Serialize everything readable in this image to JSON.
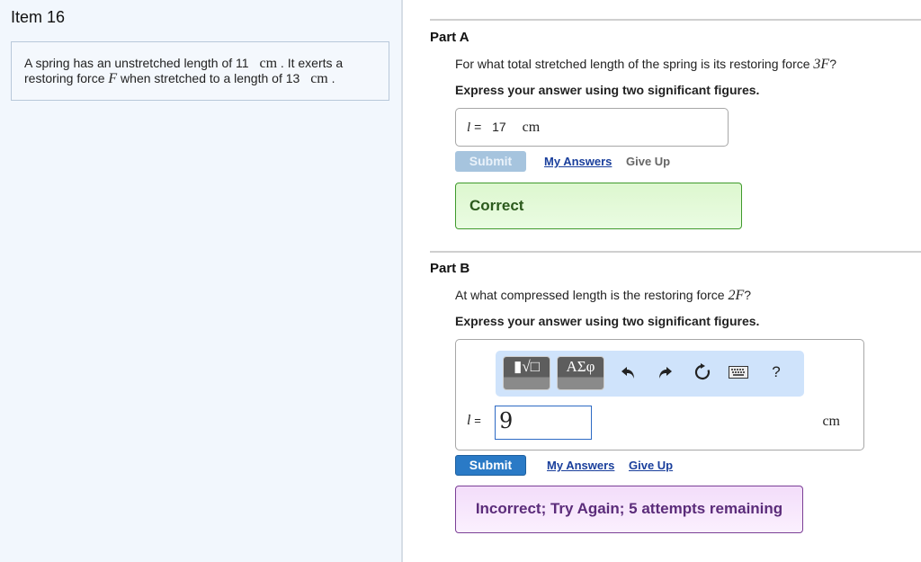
{
  "item": {
    "title": "Item 16",
    "problem": {
      "text1": "A spring has an unstretched length of 11",
      "unit1": "cm",
      "text2": ". It exerts a",
      "text3": "restoring force",
      "var": "F",
      "text4": "when stretched to a length of 13",
      "unit2": "cm",
      "text5": "."
    }
  },
  "part_a": {
    "title": "Part A",
    "question": "For what total stretched length of the spring is its restoring force",
    "question_math": "3F",
    "question_end": "?",
    "instruction": "Express your answer using two significant figures.",
    "answer": {
      "variable": "l",
      "equals": "=",
      "value": "17",
      "unit": "cm"
    },
    "submit_label": "Submit",
    "my_answers_label": "My Answers",
    "give_up_label": "Give Up",
    "feedback": "Correct",
    "submit_enabled": false
  },
  "part_b": {
    "title": "Part B",
    "question": "At what compressed length is the restoring force",
    "question_math": "2F",
    "question_end": "?",
    "instruction": "Express your answer using two significant figures.",
    "toolbar": {
      "templates_label": "▮√□",
      "symbols_label": "ΑΣφ",
      "icons": [
        "undo-icon",
        "redo-icon",
        "reset-icon",
        "keyboard-icon",
        "help-icon"
      ],
      "help_label": "?"
    },
    "answer": {
      "variable": "l",
      "equals": "=",
      "value": "9",
      "unit": "cm"
    },
    "submit_label": "Submit",
    "my_answers_label": "My Answers",
    "give_up_label": "Give Up",
    "feedback": "Incorrect; Try Again; 5 attempts remaining",
    "submit_enabled": true
  },
  "colors": {
    "correct_border": "#3f9a2c",
    "incorrect_border": "#7b3f96",
    "submit_active": "#2a7ac6",
    "link": "#1a3f9c"
  }
}
